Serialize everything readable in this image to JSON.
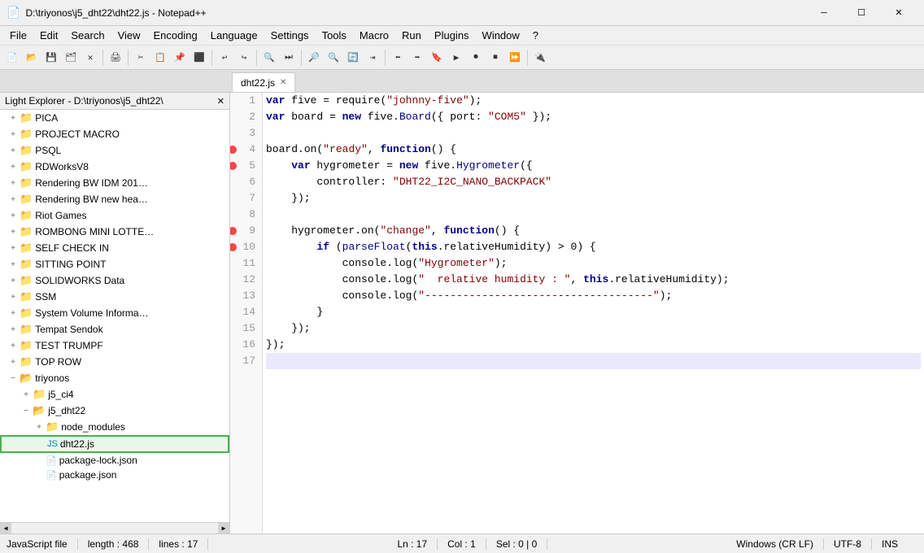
{
  "titleBar": {
    "icon": "📄",
    "title": "D:\\triyonos\\j5_dht22\\dht22.js - Notepad++",
    "minimizeLabel": "─",
    "maximizeLabel": "☐",
    "closeLabel": "✕"
  },
  "menuBar": {
    "items": [
      "File",
      "Edit",
      "Search",
      "View",
      "Encoding",
      "Language",
      "Settings",
      "Tools",
      "Macro",
      "Run",
      "Plugins",
      "Window",
      "?"
    ]
  },
  "tabs": [
    {
      "label": "dht22.js",
      "active": true,
      "closeLabel": "✕"
    }
  ],
  "sidebar": {
    "header": "Light Explorer - D:\\triyonos\\j5_dht22\\",
    "closeLabel": "✕",
    "items": [
      {
        "label": "PICA",
        "indent": 1,
        "type": "folder",
        "expanded": false
      },
      {
        "label": "PROJECT MACRO",
        "indent": 1,
        "type": "folder",
        "expanded": false
      },
      {
        "label": "PSQL",
        "indent": 1,
        "type": "folder",
        "expanded": false
      },
      {
        "label": "RDWorksV8",
        "indent": 1,
        "type": "folder",
        "expanded": false
      },
      {
        "label": "Rendering BW IDM 201?",
        "indent": 1,
        "type": "folder",
        "expanded": false
      },
      {
        "label": "Rendering BW new hea…",
        "indent": 1,
        "type": "folder",
        "expanded": false
      },
      {
        "label": "Riot Games",
        "indent": 1,
        "type": "folder",
        "expanded": false
      },
      {
        "label": "ROMBONG MINI LOTTE…",
        "indent": 1,
        "type": "folder",
        "expanded": false
      },
      {
        "label": "SELF CHECK IN",
        "indent": 1,
        "type": "folder",
        "expanded": false
      },
      {
        "label": "SITTING POINT",
        "indent": 1,
        "type": "folder",
        "expanded": false
      },
      {
        "label": "SOLIDWORKS Data",
        "indent": 1,
        "type": "folder",
        "expanded": false
      },
      {
        "label": "SSM",
        "indent": 1,
        "type": "folder",
        "expanded": false
      },
      {
        "label": "System Volume Informa…",
        "indent": 1,
        "type": "folder",
        "expanded": false
      },
      {
        "label": "Tempat Sendok",
        "indent": 1,
        "type": "folder",
        "expanded": false
      },
      {
        "label": "TEST TRUMPF",
        "indent": 1,
        "type": "folder",
        "expanded": false
      },
      {
        "label": "TOP ROW",
        "indent": 1,
        "type": "folder",
        "expanded": false
      },
      {
        "label": "triyonos",
        "indent": 1,
        "type": "folder",
        "expanded": true
      },
      {
        "label": "j5_ci4",
        "indent": 2,
        "type": "folder",
        "expanded": false
      },
      {
        "label": "j5_dht22",
        "indent": 2,
        "type": "folder",
        "expanded": true
      },
      {
        "label": "node_modules",
        "indent": 3,
        "type": "folder",
        "expanded": false
      },
      {
        "label": "dht22.js",
        "indent": 3,
        "type": "file-js",
        "expanded": false,
        "selected": true,
        "highlighted": true
      },
      {
        "label": "package-lock.json",
        "indent": 3,
        "type": "file",
        "expanded": false
      },
      {
        "label": "package.json",
        "indent": 3,
        "type": "file",
        "expanded": false
      }
    ]
  },
  "code": {
    "lines": [
      {
        "num": 1,
        "content": "var five = require(\"johnny-five\");",
        "breakpoint": false
      },
      {
        "num": 2,
        "content": "var board = new five.Board({ port: \"COM5\" });",
        "breakpoint": false
      },
      {
        "num": 3,
        "content": "",
        "breakpoint": false
      },
      {
        "num": 4,
        "content": "board.on(\"ready\", function() {",
        "breakpoint": true
      },
      {
        "num": 5,
        "content": "    var hygrometer = new five.Hygrometer({",
        "breakpoint": true
      },
      {
        "num": 6,
        "content": "        controller: \"DHT22_I2C_NANO_BACKPACK\"",
        "breakpoint": false
      },
      {
        "num": 7,
        "content": "    });",
        "breakpoint": false
      },
      {
        "num": 8,
        "content": "",
        "breakpoint": false
      },
      {
        "num": 9,
        "content": "    hygrometer.on(\"change\", function() {",
        "breakpoint": true
      },
      {
        "num": 10,
        "content": "        if (parseFloat(this.relativeHumidity) > 0) {",
        "breakpoint": true
      },
      {
        "num": 11,
        "content": "            console.log(\"Hygrometer\");",
        "breakpoint": false
      },
      {
        "num": 12,
        "content": "            console.log(\"  relative humidity : \", this.relativeHumidity);",
        "breakpoint": false
      },
      {
        "num": 13,
        "content": "            console.log(\"------------------------------------\");",
        "breakpoint": false
      },
      {
        "num": 14,
        "content": "        }",
        "breakpoint": false
      },
      {
        "num": 15,
        "content": "    });",
        "breakpoint": false
      },
      {
        "num": 16,
        "content": "});",
        "breakpoint": false
      },
      {
        "num": 17,
        "content": "",
        "breakpoint": false,
        "highlighted": true
      }
    ]
  },
  "statusBar": {
    "fileType": "JavaScript file",
    "length": "length : 468",
    "lines": "lines : 17",
    "cursor": "Ln : 17",
    "col": "Col : 1",
    "sel": "Sel : 0 | 0",
    "lineEnding": "Windows (CR LF)",
    "encoding": "UTF-8",
    "insertMode": "INS"
  }
}
